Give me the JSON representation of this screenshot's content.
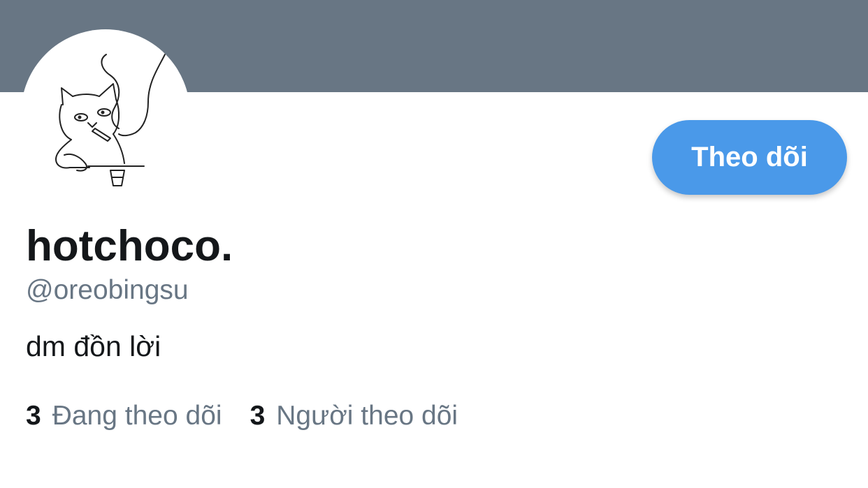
{
  "profile": {
    "display_name": "hotchoco.",
    "handle": "@oreobingsu",
    "bio": "dm đồn lời",
    "avatar_icon": "cat-smoking-drawing-icon"
  },
  "actions": {
    "follow_label": "Theo dõi"
  },
  "stats": {
    "following_count": "3",
    "following_label": "Đang theo dõi",
    "followers_count": "3",
    "followers_label": "Người theo dõi"
  },
  "colors": {
    "banner": "#687684",
    "accent": "#4a99e9",
    "text_primary": "#14171a",
    "text_secondary": "#687684"
  }
}
